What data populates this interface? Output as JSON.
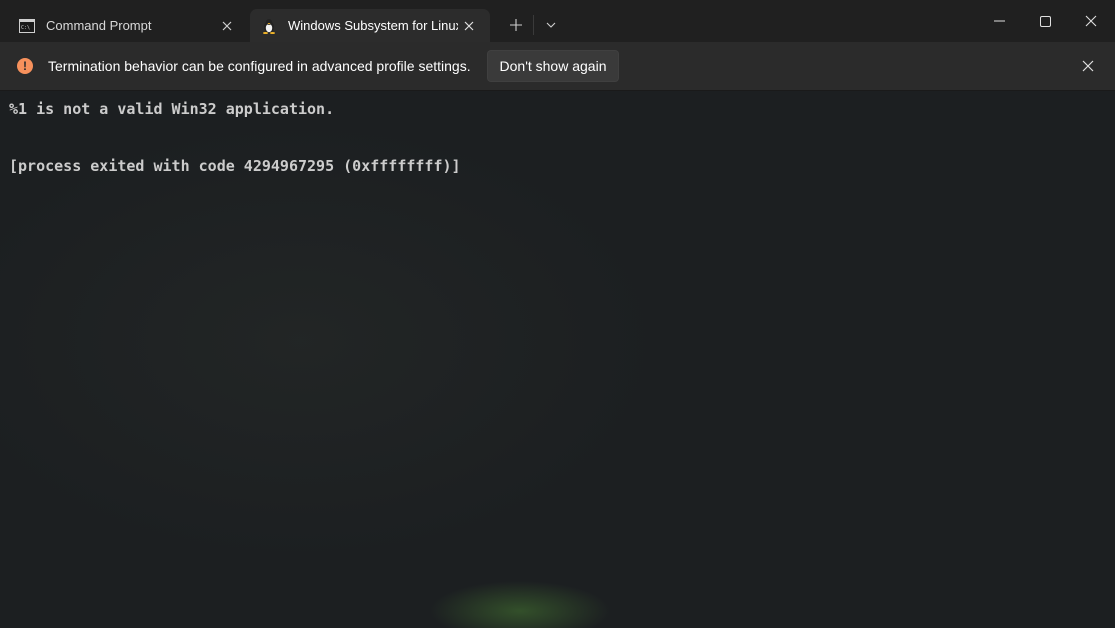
{
  "tabs": [
    {
      "label": "Command Prompt",
      "icon": "command-prompt-icon",
      "active": false
    },
    {
      "label": "Windows Subsystem for Linux",
      "icon": "linux-penguin-icon",
      "active": true
    }
  ],
  "infobar": {
    "message": "Termination behavior can be configured in advanced profile settings.",
    "button_label": "Don't show again",
    "icon": "warning-icon",
    "icon_glyph": "!",
    "accent_color": "#f7915c"
  },
  "terminal": {
    "lines": [
      "%1 is not a valid Win32 application.",
      "[process exited with code 4294967295 (0xffffffff)]"
    ]
  },
  "colors": {
    "background": "#1c1f21",
    "titlebar": "#202020",
    "active_tab": "#2c2c2c",
    "infobar": "#2b2b2b"
  }
}
